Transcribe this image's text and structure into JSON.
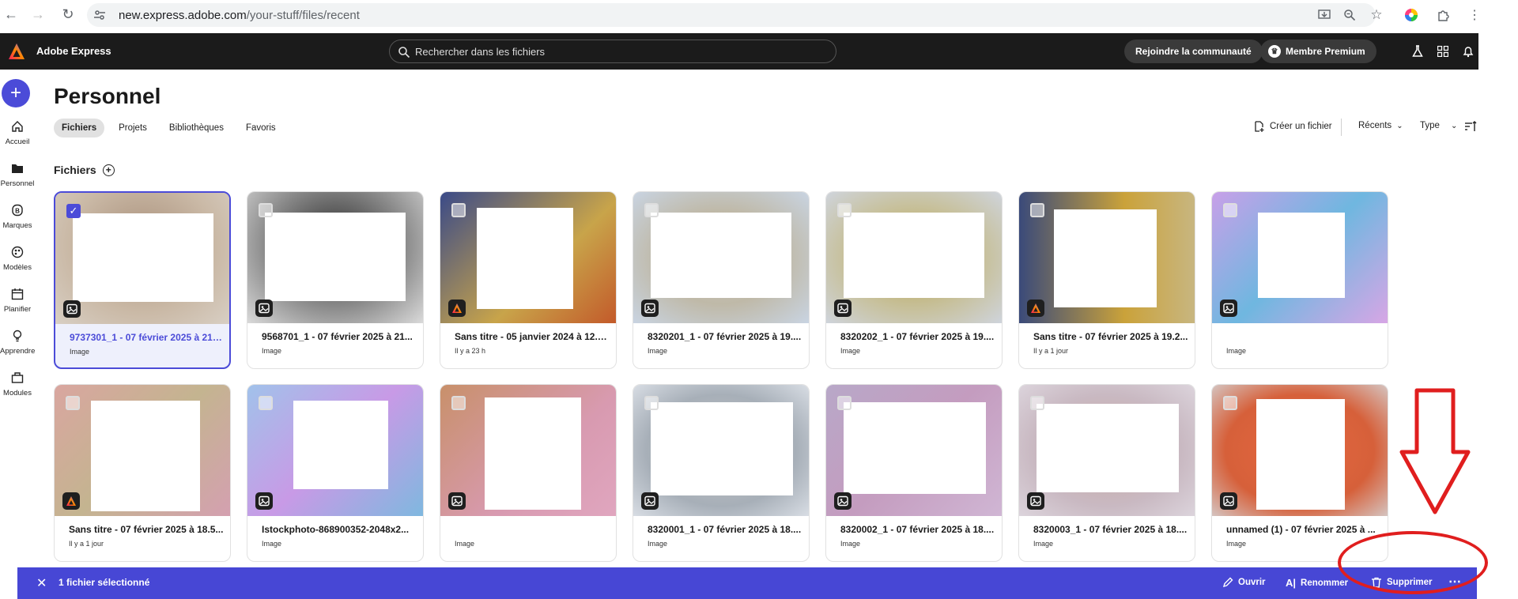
{
  "browser": {
    "url_host": "new.express.adobe.com",
    "url_path": "/your-stuff/files/recent"
  },
  "header": {
    "app_name": "Adobe Express",
    "search_placeholder": "Rechercher dans les fichiers",
    "community_label": "Rejoindre la communauté",
    "premium_label": "Membre Premium"
  },
  "rail": {
    "items": [
      {
        "label": "Accueil"
      },
      {
        "label": "Personnel"
      },
      {
        "label": "Marques"
      },
      {
        "label": "Modèles"
      },
      {
        "label": "Planifier"
      },
      {
        "label": "Apprendre"
      },
      {
        "label": "Modules"
      }
    ]
  },
  "main": {
    "title": "Personnel",
    "tabs": [
      "Fichiers",
      "Projets",
      "Bibliothèques",
      "Favoris"
    ],
    "create_file": "Créer un fichier",
    "sort_label": "Récents",
    "type_label": "Type",
    "section_title": "Fichiers"
  },
  "files": [
    {
      "name": "9737301_1 - 07 février 2025 à 21.1...",
      "meta": "Image",
      "selected": true,
      "express": false
    },
    {
      "name": "9568701_1 - 07 février 2025 à 21...",
      "meta": "Image",
      "selected": false,
      "express": false
    },
    {
      "name": "Sans titre - 05 janvier 2024 à 12.1...",
      "meta": "Il y a 23 h",
      "selected": false,
      "express": true
    },
    {
      "name": "8320201_1 - 07 février 2025 à 19....",
      "meta": "Image",
      "selected": false,
      "express": false
    },
    {
      "name": "8320202_1 - 07 février 2025 à 19....",
      "meta": "Image",
      "selected": false,
      "express": false
    },
    {
      "name": "Sans titre - 07 février 2025 à 19.2...",
      "meta": "Il y a 1 jour",
      "selected": false,
      "express": true
    },
    {
      "name": "",
      "meta": "Image",
      "selected": false,
      "express": false
    },
    {
      "name": "Sans titre - 07 février 2025 à 18.5...",
      "meta": "Il y a 1 jour",
      "selected": false,
      "express": true
    },
    {
      "name": "Istockphoto-868900352-2048x2...",
      "meta": "Image",
      "selected": false,
      "express": false
    },
    {
      "name": "",
      "meta": "Image",
      "selected": false,
      "express": false
    },
    {
      "name": "8320001_1 - 07 février 2025 à 18....",
      "meta": "Image",
      "selected": false,
      "express": false
    },
    {
      "name": "8320002_1 - 07 février 2025 à 18....",
      "meta": "Image",
      "selected": false,
      "express": false
    },
    {
      "name": "8320003_1 - 07 février 2025 à 18....",
      "meta": "Image",
      "selected": false,
      "express": false
    },
    {
      "name": "unnamed (1) - 07 février 2025 à ...",
      "meta": "Image",
      "selected": false,
      "express": false
    }
  ],
  "action_bar": {
    "selected_text": "1 fichier sélectionné",
    "open_label": "Ouvrir",
    "rename_label": "Renommer",
    "delete_label": "Supprimer"
  },
  "colors": {
    "accent": "#4b4bd8",
    "annotation": "#e01e1e",
    "header_bg": "#1b1b1b"
  }
}
